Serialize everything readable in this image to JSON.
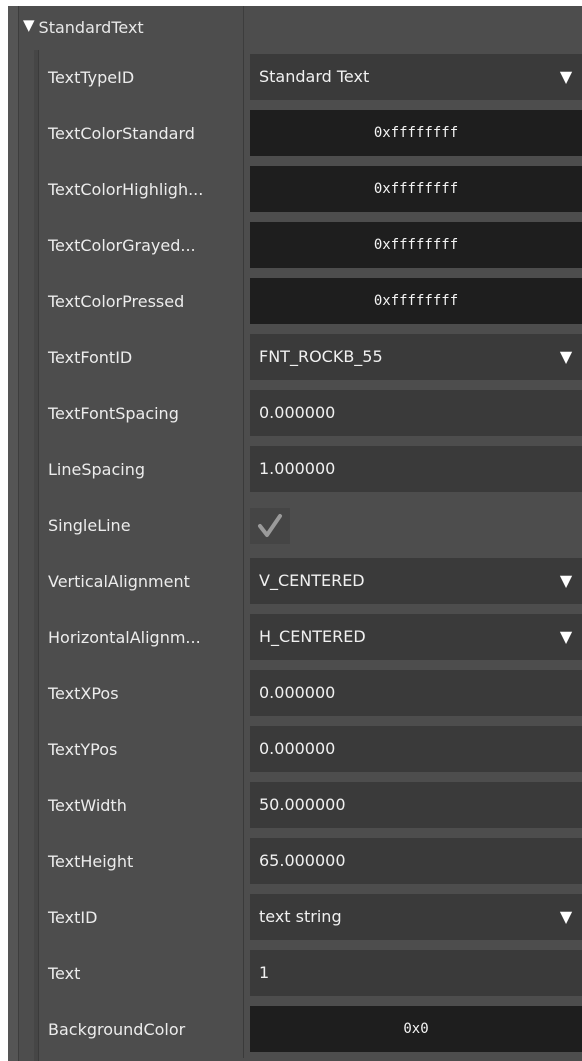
{
  "section": {
    "title": "StandardText",
    "expanded": true,
    "expand_icon": "triangle-down-icon"
  },
  "rows": [
    {
      "label": "TextTypeID",
      "type": "dropdown",
      "value": "Standard Text"
    },
    {
      "label": "TextColorStandard",
      "type": "color",
      "value": "0xffffffff"
    },
    {
      "label": "TextColorHighligh...",
      "type": "color",
      "value": "0xffffffff"
    },
    {
      "label": "TextColorGrayed...",
      "type": "color",
      "value": "0xffffffff"
    },
    {
      "label": "TextColorPressed",
      "type": "color",
      "value": "0xffffffff"
    },
    {
      "label": "TextFontID",
      "type": "dropdown",
      "value": "FNT_ROCKB_55"
    },
    {
      "label": "TextFontSpacing",
      "type": "text",
      "value": "0.000000"
    },
    {
      "label": "LineSpacing",
      "type": "text",
      "value": "1.000000"
    },
    {
      "label": "SingleLine",
      "type": "checkbox",
      "checked": true
    },
    {
      "label": "VerticalAlignment",
      "type": "dropdown",
      "value": "V_CENTERED"
    },
    {
      "label": "HorizontalAlignm...",
      "type": "dropdown",
      "value": "H_CENTERED"
    },
    {
      "label": "TextXPos",
      "type": "text",
      "value": "0.000000"
    },
    {
      "label": "TextYPos",
      "type": "text",
      "value": "0.000000"
    },
    {
      "label": "TextWidth",
      "type": "text",
      "value": "50.000000"
    },
    {
      "label": "TextHeight",
      "type": "text",
      "value": "65.000000"
    },
    {
      "label": "TextID",
      "type": "dropdown",
      "value": "text string"
    },
    {
      "label": "Text",
      "type": "text",
      "value": "1"
    },
    {
      "label": "BackgroundColor",
      "type": "color",
      "value": "0x0"
    }
  ],
  "icons": {
    "dropdown": "dropdown-arrow-icon",
    "checkbox": "checkmark-icon"
  },
  "colors": {
    "panel_bg": "#4d4d4d",
    "field_bg": "#3a3a3a",
    "color_field_bg": "#1e1e1e",
    "text": "#ececec",
    "checkmark": "#9a9a9a"
  }
}
